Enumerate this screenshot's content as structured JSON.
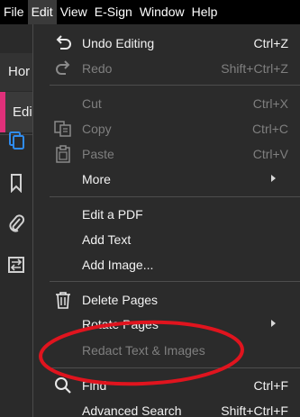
{
  "menubar": {
    "items": [
      {
        "label": "File"
      },
      {
        "label": "Edit"
      },
      {
        "label": "View"
      },
      {
        "label": "E-Sign"
      },
      {
        "label": "Window"
      },
      {
        "label": "Help"
      }
    ]
  },
  "sidebar": {
    "home_label": "Hor",
    "edit_label": "Edi",
    "edit_accent_color": "#e0307a",
    "icons": [
      "pages-icon",
      "bookmark-icon",
      "attachment-icon",
      "compare-icon"
    ]
  },
  "edit_menu": {
    "undo": {
      "label": "Undo Editing",
      "shortcut": "Ctrl+Z"
    },
    "redo": {
      "label": "Redo",
      "shortcut": "Shift+Ctrl+Z"
    },
    "cut": {
      "label": "Cut",
      "shortcut": "Ctrl+X"
    },
    "copy": {
      "label": "Copy",
      "shortcut": "Ctrl+C"
    },
    "paste": {
      "label": "Paste",
      "shortcut": "Ctrl+V"
    },
    "more": {
      "label": "More"
    },
    "edit_pdf": {
      "label": "Edit a PDF"
    },
    "add_text": {
      "label": "Add Text"
    },
    "add_image": {
      "label": "Add Image..."
    },
    "delete_pages": {
      "label": "Delete Pages"
    },
    "rotate_pages": {
      "label": "Rotate Pages"
    },
    "redact": {
      "label": "Redact Text & Images"
    },
    "find": {
      "label": "Find",
      "shortcut": "Ctrl+F"
    },
    "advanced_search": {
      "label": "Advanced Search",
      "shortcut": "Shift+Ctrl+F"
    }
  },
  "annotation": {
    "color": "#e0141e",
    "target": "Redact Text & Images"
  }
}
